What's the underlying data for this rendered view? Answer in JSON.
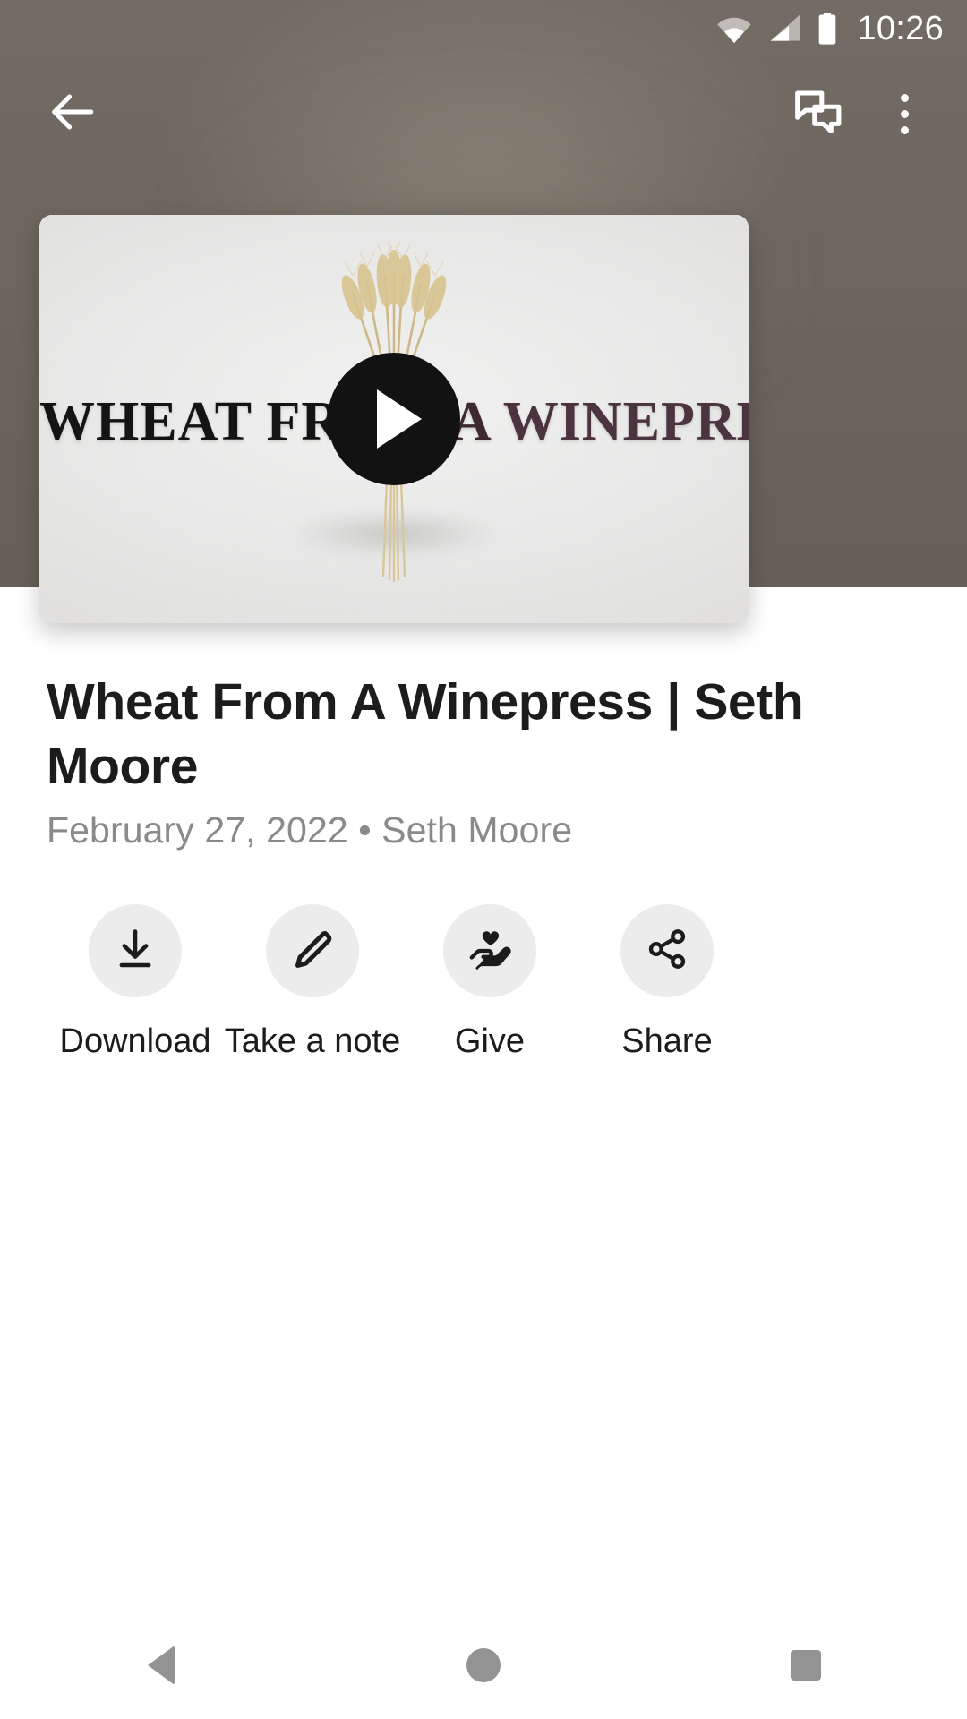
{
  "status_bar": {
    "time": "10:26",
    "icons": [
      "wifi-icon",
      "cellular-signal-icon",
      "battery-icon"
    ]
  },
  "toolbar": {
    "back_label": "Back",
    "back_icon": "arrow-left-icon",
    "chat_label": "Discussion",
    "chat_icon": "chat-bubbles-icon",
    "overflow_label": "More options",
    "overflow_icon": "more-vertical-icon"
  },
  "video": {
    "play_label": "Play",
    "play_icon": "play-triangle-icon",
    "thumbnail_title_part1": "WHEAT FR",
    "thumbnail_title_part2": "OM A ",
    "thumbnail_title_part3": "WINEPRESS",
    "thumbnail_alt": "wheat-sheaf-thumbnail"
  },
  "media": {
    "title": "Wheat From A Winepress | Seth Moore",
    "meta": "February 27, 2022 • Seth Moore",
    "date": "February 27, 2022",
    "speaker": "Seth Moore"
  },
  "actions": [
    {
      "label": "Download",
      "icon": "download-arrow-icon"
    },
    {
      "label": "Take a note",
      "icon": "pencil-icon"
    },
    {
      "label": "Give",
      "icon": "hand-heart-icon"
    },
    {
      "label": "Share",
      "icon": "share-nodes-icon"
    }
  ],
  "nav_bar": {
    "back_label": "Back",
    "home_label": "Home",
    "recents_label": "Recents"
  },
  "colors": {
    "backdrop": "#6e675f",
    "sheet": "#ffffff",
    "title_text": "#1c1c1c",
    "meta_text": "#8a8a8a",
    "action_circle": "#ececec",
    "nav_icon": "#939393",
    "play_button": "#121212"
  }
}
